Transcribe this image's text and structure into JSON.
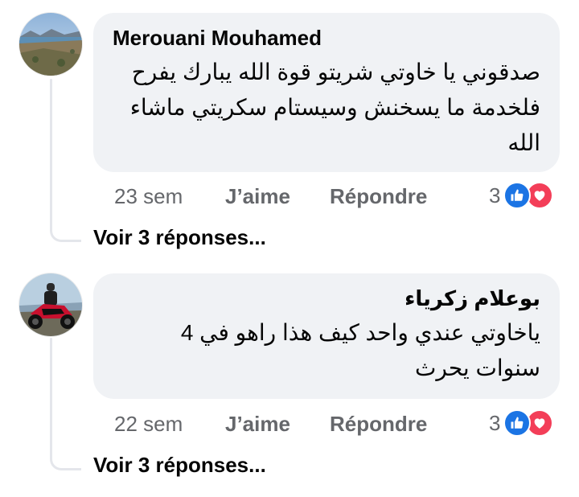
{
  "comments": [
    {
      "author": "Merouani Mouhamed",
      "text": "صدقوني يا خاوتي شريتو قوة الله يبارك يفرح فلخدمة ما يسخنش وسيستام سكريتي ماشاء الله",
      "timestamp": "23 sem",
      "like_label": "J’aime",
      "reply_label": "Répondre",
      "reaction_count": "3",
      "reactions": [
        "like-icon",
        "love-icon"
      ],
      "view_replies": "Voir 3 réponses..."
    },
    {
      "author": "بوعلام زكرياء",
      "text": "ياخاوتي عندي واحد كيف هذا راهو في 4 سنوات يحرث",
      "timestamp": "22 sem",
      "like_label": "J’aime",
      "reply_label": "Répondre",
      "reaction_count": "3",
      "reactions": [
        "like-icon",
        "love-icon"
      ],
      "view_replies": "Voir 3 réponses..."
    }
  ],
  "colors": {
    "bubble": "#f0f2f5",
    "secondary_text": "#65676b",
    "like_blue": "#1b74e4",
    "love_red": "#f33e58",
    "thread_line": "#e4e6eb"
  }
}
